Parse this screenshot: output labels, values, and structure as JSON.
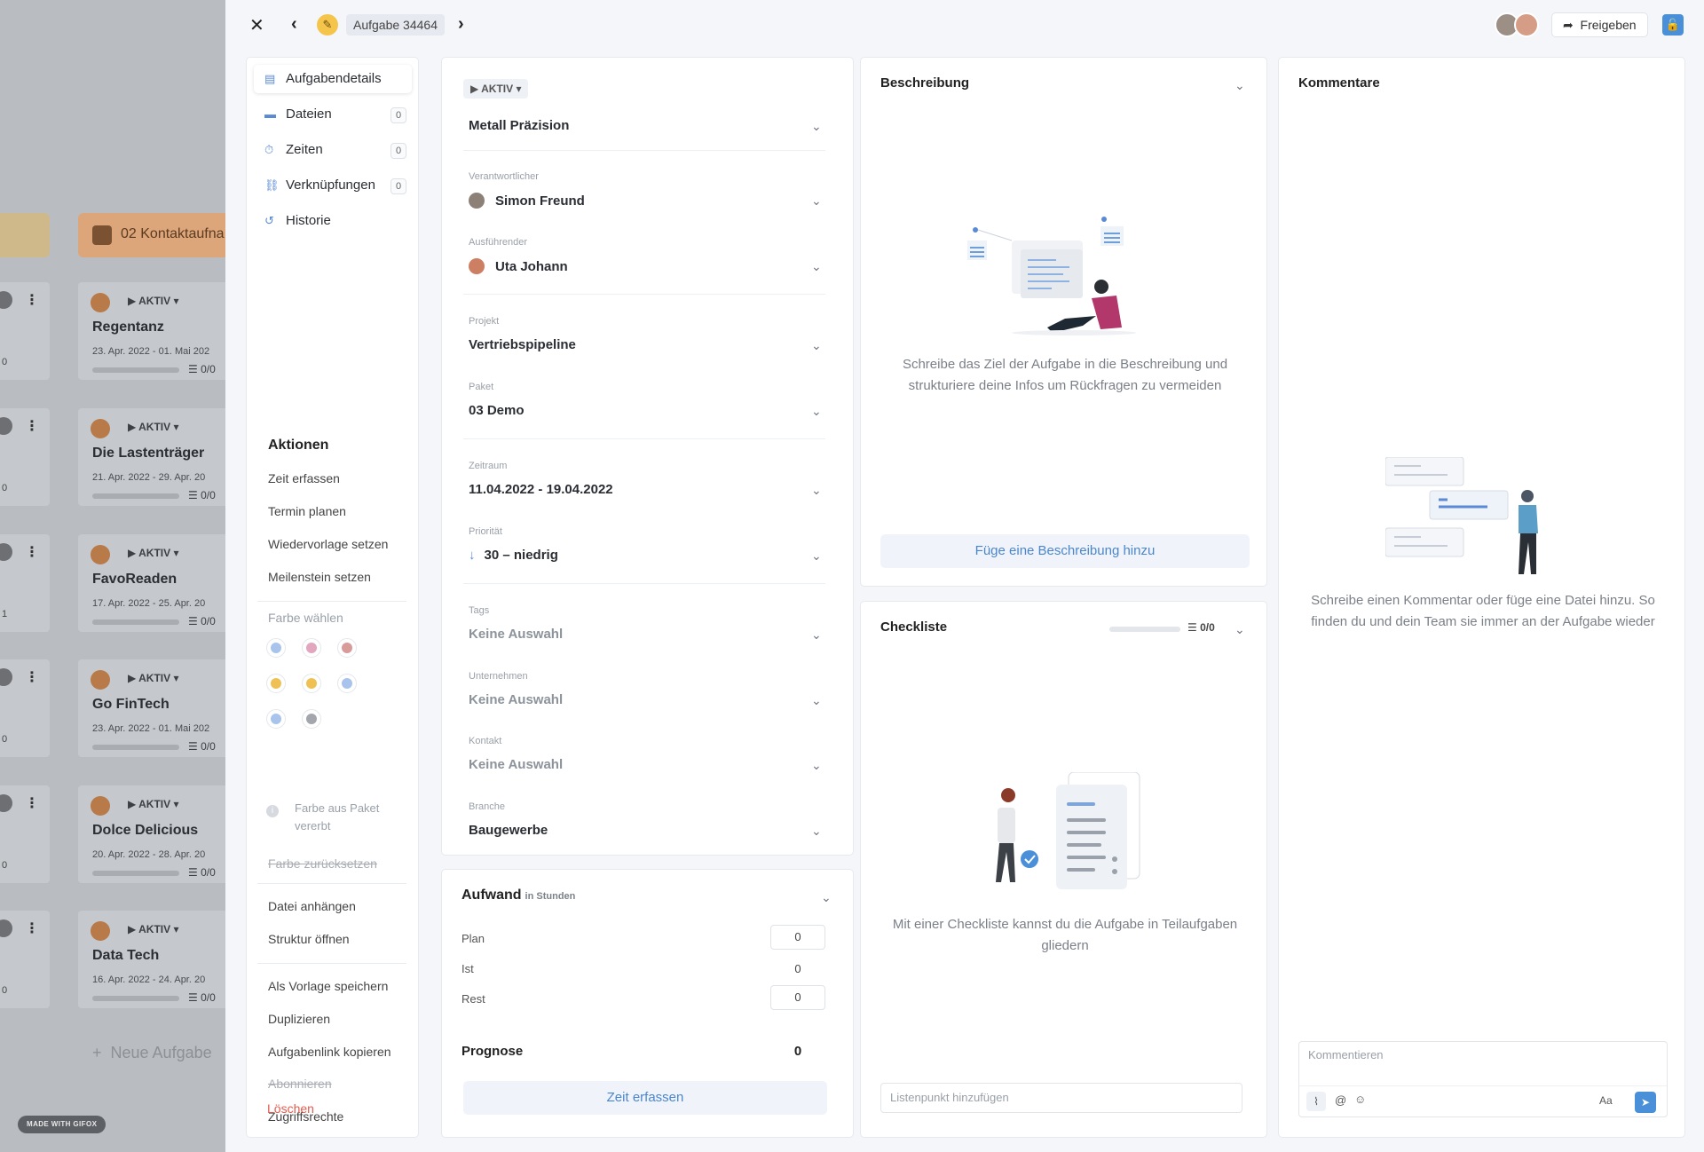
{
  "background": {
    "column_title": "02 Kontaktaufna",
    "new_task": "Neue Aufgabe",
    "gifox_badge": "MADE WITH GIFOX",
    "cards": [
      {
        "status": "AKTIV",
        "name": "Regentanz",
        "dates": "23. Apr. 2022 - 01. Mai 202",
        "checklist": "0/0",
        "links": "0"
      },
      {
        "status": "AKTIV",
        "name": "Die Lastenträger",
        "dates": "21. Apr. 2022 - 29. Apr. 20",
        "checklist": "0/0",
        "links": "0"
      },
      {
        "status": "AKTIV",
        "name": "FavoReaden",
        "dates": "17. Apr. 2022 - 25. Apr. 20",
        "checklist": "0/0",
        "links": "1"
      },
      {
        "status": "AKTIV",
        "name": "Go FinTech",
        "dates": "23. Apr. 2022 - 01. Mai 202",
        "checklist": "0/0",
        "links": "0"
      },
      {
        "status": "AKTIV",
        "name": "Dolce Delicious",
        "dates": "20. Apr. 2022 - 28. Apr. 20",
        "checklist": "0/0",
        "links": "0"
      },
      {
        "status": "AKTIV",
        "name": "Data Tech",
        "dates": "16. Apr. 2022 - 24. Apr. 20",
        "checklist": "0/0",
        "links": "0"
      }
    ]
  },
  "header": {
    "close_icon": "close-icon",
    "task_label": "Aufgabe 34464",
    "share_label": "Freigeben"
  },
  "menu": {
    "items": [
      {
        "label": "Aufgabendetails",
        "icon": "clipboard-icon"
      },
      {
        "label": "Dateien",
        "icon": "folder-icon",
        "count": "0"
      },
      {
        "label": "Zeiten",
        "icon": "stopwatch-icon",
        "count": "0"
      },
      {
        "label": "Verknüpfungen",
        "icon": "link-icon",
        "count": "0"
      },
      {
        "label": "Historie",
        "icon": "history-icon"
      }
    ],
    "actions_title": "Aktionen",
    "actions": [
      "Zeit erfassen",
      "Termin planen",
      "Wiedervorlage setzen",
      "Meilenstein setzen"
    ],
    "color_title": "Farbe wählen",
    "colors": [
      "#a9c4ec",
      "#e2a6be",
      "#d99a9a",
      "#efc155",
      "#efc155",
      "#a9c4ec",
      "#a9c4ec",
      "#a3a7ad"
    ],
    "inherit_text": "Farbe aus Paket vererbt",
    "reset_color": "Farbe zurücksetzen",
    "actions2": [
      "Datei anhängen",
      "Struktur öffnen"
    ],
    "actions3": [
      "Als Vorlage speichern",
      "Duplizieren",
      "Aufgabenlink kopieren"
    ],
    "subscribe": "Abonnieren",
    "access": "Zugriffsrechte",
    "delete": "Löschen"
  },
  "details": {
    "status": "AKTIV",
    "company_title": "Metall Präzision",
    "fields": {
      "responsible": {
        "label": "Verantwortlicher",
        "value": "Simon Freund"
      },
      "executor": {
        "label": "Ausführender",
        "value": "Uta Johann"
      },
      "project": {
        "label": "Projekt",
        "value": "Vertriebspipeline"
      },
      "package": {
        "label": "Paket",
        "value": "03 Demo"
      },
      "period": {
        "label": "Zeitraum",
        "value": "11.04.2022 - 19.04.2022"
      },
      "priority": {
        "label": "Priorität",
        "value": "30 – niedrig"
      },
      "tags": {
        "label": "Tags",
        "value": "Keine Auswahl"
      },
      "company": {
        "label": "Unternehmen",
        "value": "Keine Auswahl"
      },
      "contact": {
        "label": "Kontakt",
        "value": "Keine Auswahl"
      },
      "industry": {
        "label": "Branche",
        "value": "Baugewerbe"
      }
    }
  },
  "effort": {
    "title": "Aufwand",
    "unit": "in Stunden",
    "plan_label": "Plan",
    "plan_value": "0",
    "actual_label": "Ist",
    "actual_value": "0",
    "rest_label": "Rest",
    "rest_value": "0",
    "forecast_label": "Prognose",
    "forecast_value": "0",
    "button": "Zeit erfassen"
  },
  "description": {
    "title": "Beschreibung",
    "hint": "Schreibe das Ziel der Aufgabe in die Beschreibung und strukturiere deine Infos um Rückfragen zu vermeiden",
    "button": "Füge eine Beschreibung hinzu"
  },
  "checklist": {
    "title": "Checkliste",
    "progress_text": "0/0",
    "progress": 0,
    "hint": "Mit einer Checkliste kannst du die Aufgabe in Teilaufgaben gliedern",
    "placeholder": "Listenpunkt hinzufügen"
  },
  "comments": {
    "title": "Kommentare",
    "hint": "Schreibe einen Kommentar oder füge eine Datei hinzu. So finden du und dein Team sie immer an der Aufgabe wieder",
    "placeholder": "Kommentieren",
    "format_label": "Aa"
  },
  "colors": {
    "accent": "#4a90d9",
    "danger": "#e35b4e",
    "pencil": "#f4c54a"
  }
}
